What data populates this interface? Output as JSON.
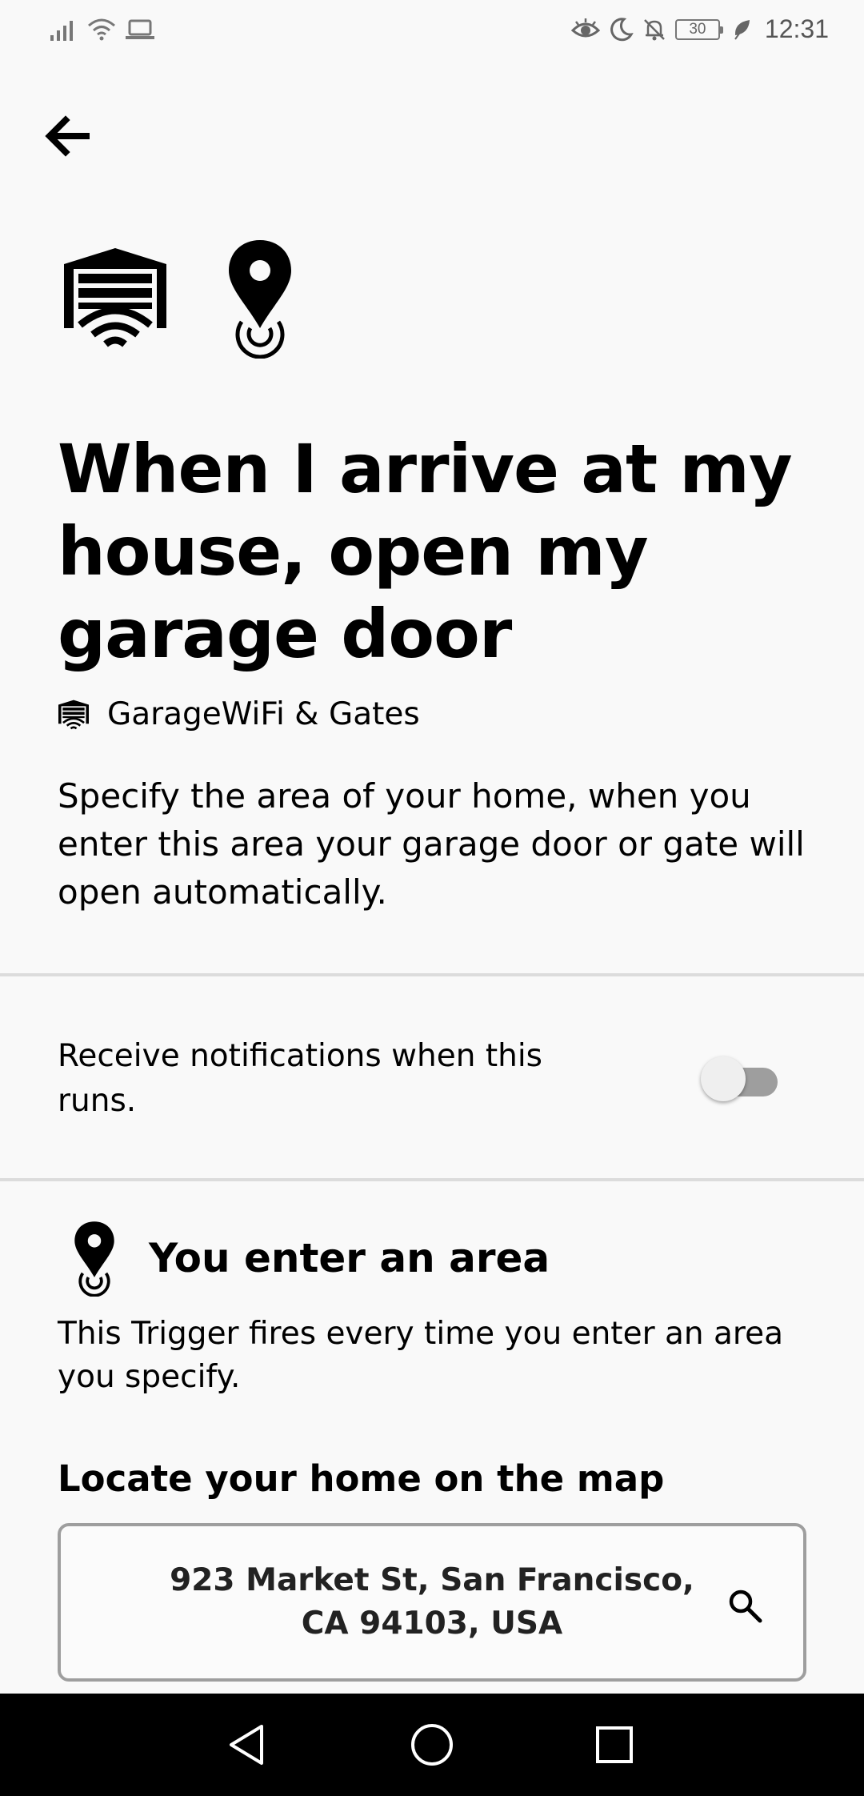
{
  "status_bar": {
    "time": "12:31",
    "battery": "30",
    "icons": [
      "signal-icon",
      "wifi-icon",
      "laptop-icon",
      "eye-icon",
      "moon-icon",
      "bell-off-icon",
      "battery-icon",
      "leaf-icon"
    ]
  },
  "header": {
    "back_icon": "arrow-left-icon"
  },
  "applet": {
    "title": "When I arrive at my house, open my garage door",
    "service_name": "GarageWiFi & Gates",
    "description": "Specify the area of your home, when you enter this area your garage door or gate will open automatically."
  },
  "notifications": {
    "label": "Receive notifications when this runs.",
    "enabled": false
  },
  "trigger": {
    "title": "You enter an area",
    "description": "This Trigger fires every time you enter an area you specify."
  },
  "location": {
    "section_title": "Locate your home on the map",
    "address": "923 Market St, San Francisco, CA 94103, USA"
  },
  "nav_bar": {
    "buttons": [
      "back-nav-icon",
      "home-nav-icon",
      "recents-nav-icon"
    ]
  },
  "colors": {
    "background": "#f9f9f9",
    "divider": "#dcdcdc",
    "toggle_off_track": "#9e9e9e",
    "nav_bar": "#000000"
  }
}
